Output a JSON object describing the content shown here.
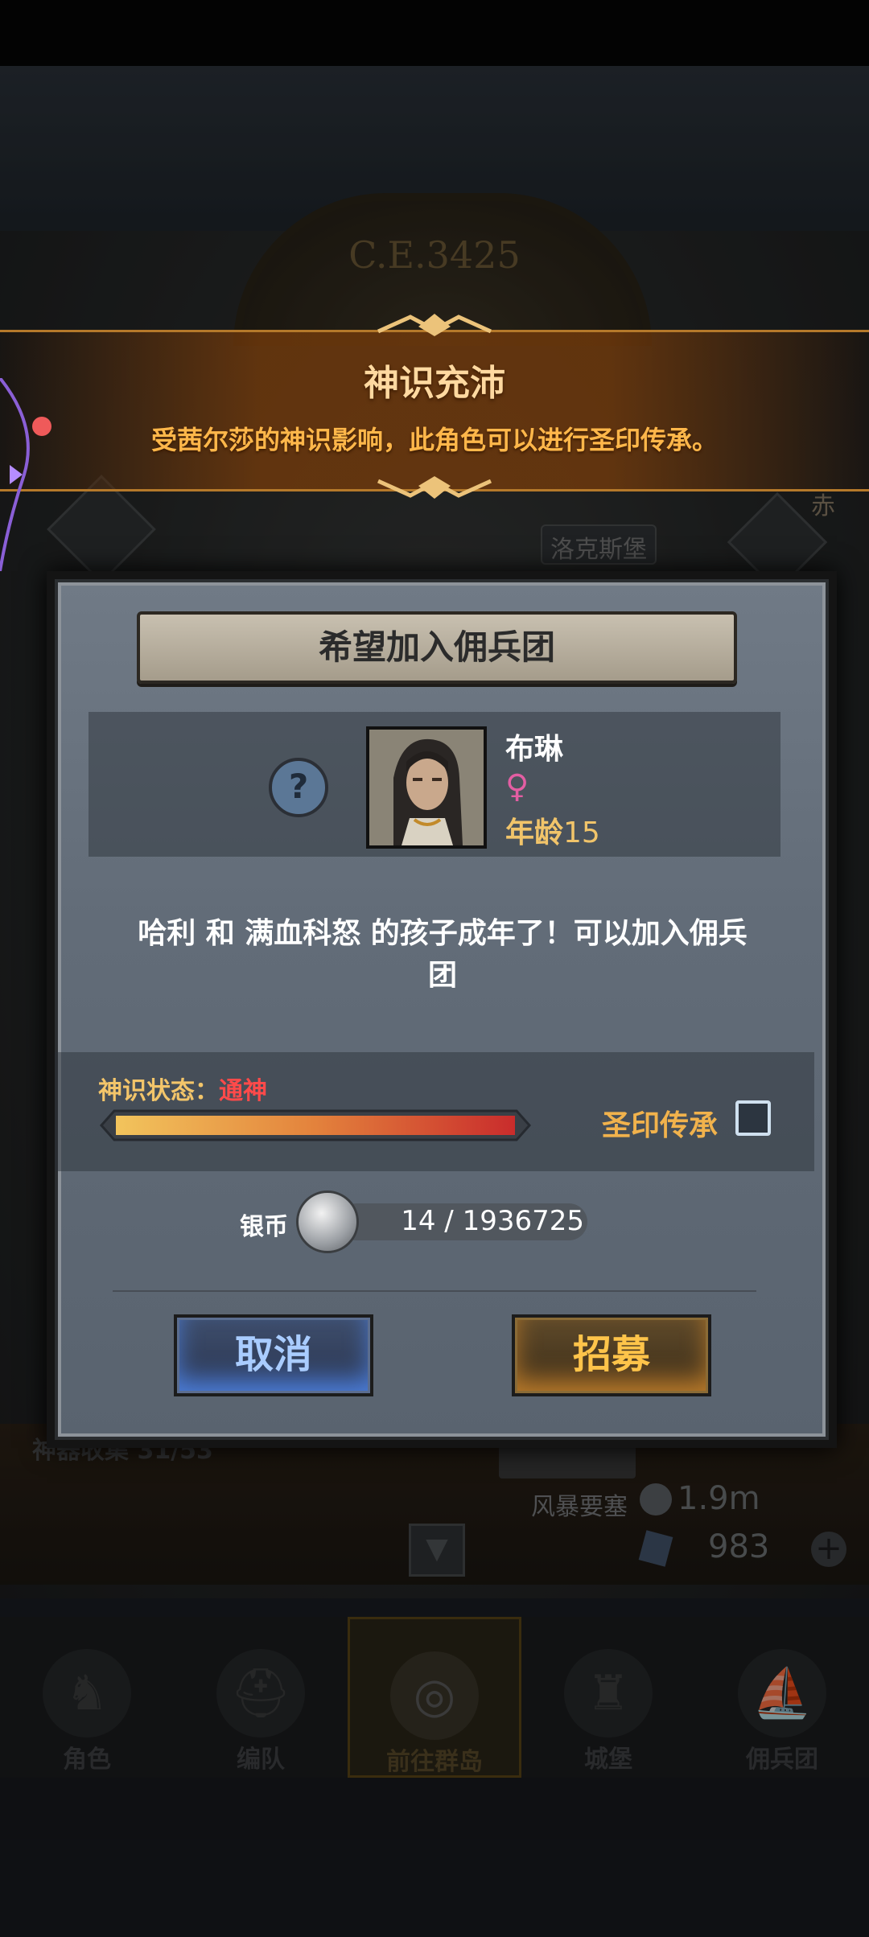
{
  "background": {
    "year_label": "C.E.3425",
    "location_top": "洛克斯堡",
    "location_top_right": "赤",
    "location_bottom": "风暴要塞",
    "artifact_label": "神器收集 31/53",
    "silver_amount": "1.9m",
    "gem_amount": "983"
  },
  "nav": {
    "items": [
      {
        "label": "角色",
        "icon": "knight-icon"
      },
      {
        "label": "编队",
        "icon": "helmet-icon"
      },
      {
        "label": "前往群岛",
        "icon": "globe-icon"
      },
      {
        "label": "城堡",
        "icon": "castle-icon"
      },
      {
        "label": "佣兵团",
        "icon": "ship-icon"
      }
    ],
    "active_index": 2
  },
  "banner": {
    "title": "神识充沛",
    "subtitle": "受茜尔莎的神识影响，此角色可以进行圣印传承。"
  },
  "dialog": {
    "title": "希望加入佣兵团",
    "character": {
      "name": "布琳",
      "gender_icon": "female-icon",
      "age_label": "年龄",
      "age": "15"
    },
    "message": "哈利 和 满血科怒 的孩子成年了！可以加入佣兵团",
    "status_label": "神识状态：",
    "status_value": "通神",
    "status_fill": 1.0,
    "heritage_label": "圣印传承",
    "heritage_checked": false,
    "coin_label": "银币",
    "coin_progress": "14 / 1936725",
    "cancel_label": "取消",
    "recruit_label": "招募"
  }
}
